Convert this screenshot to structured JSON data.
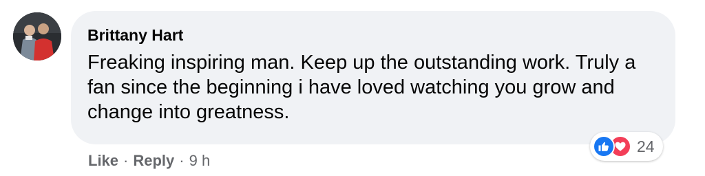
{
  "comment": {
    "author": "Brittany Hart",
    "text": "Freaking inspiring man. Keep up the outstanding work. Truly a fan since the beginning i have loved watching you grow and change into greatness.",
    "reactions": {
      "icons": [
        "like-icon",
        "love-icon"
      ],
      "count": "24",
      "like_color": "#1877f2",
      "love_color": "#f33e58"
    },
    "actions": {
      "like_label": "Like",
      "reply_label": "Reply",
      "separator": "·",
      "timestamp": "9 h"
    }
  },
  "colors": {
    "bubble_bg": "#f0f2f5",
    "text": "#050505",
    "secondary_text": "#65676b"
  }
}
